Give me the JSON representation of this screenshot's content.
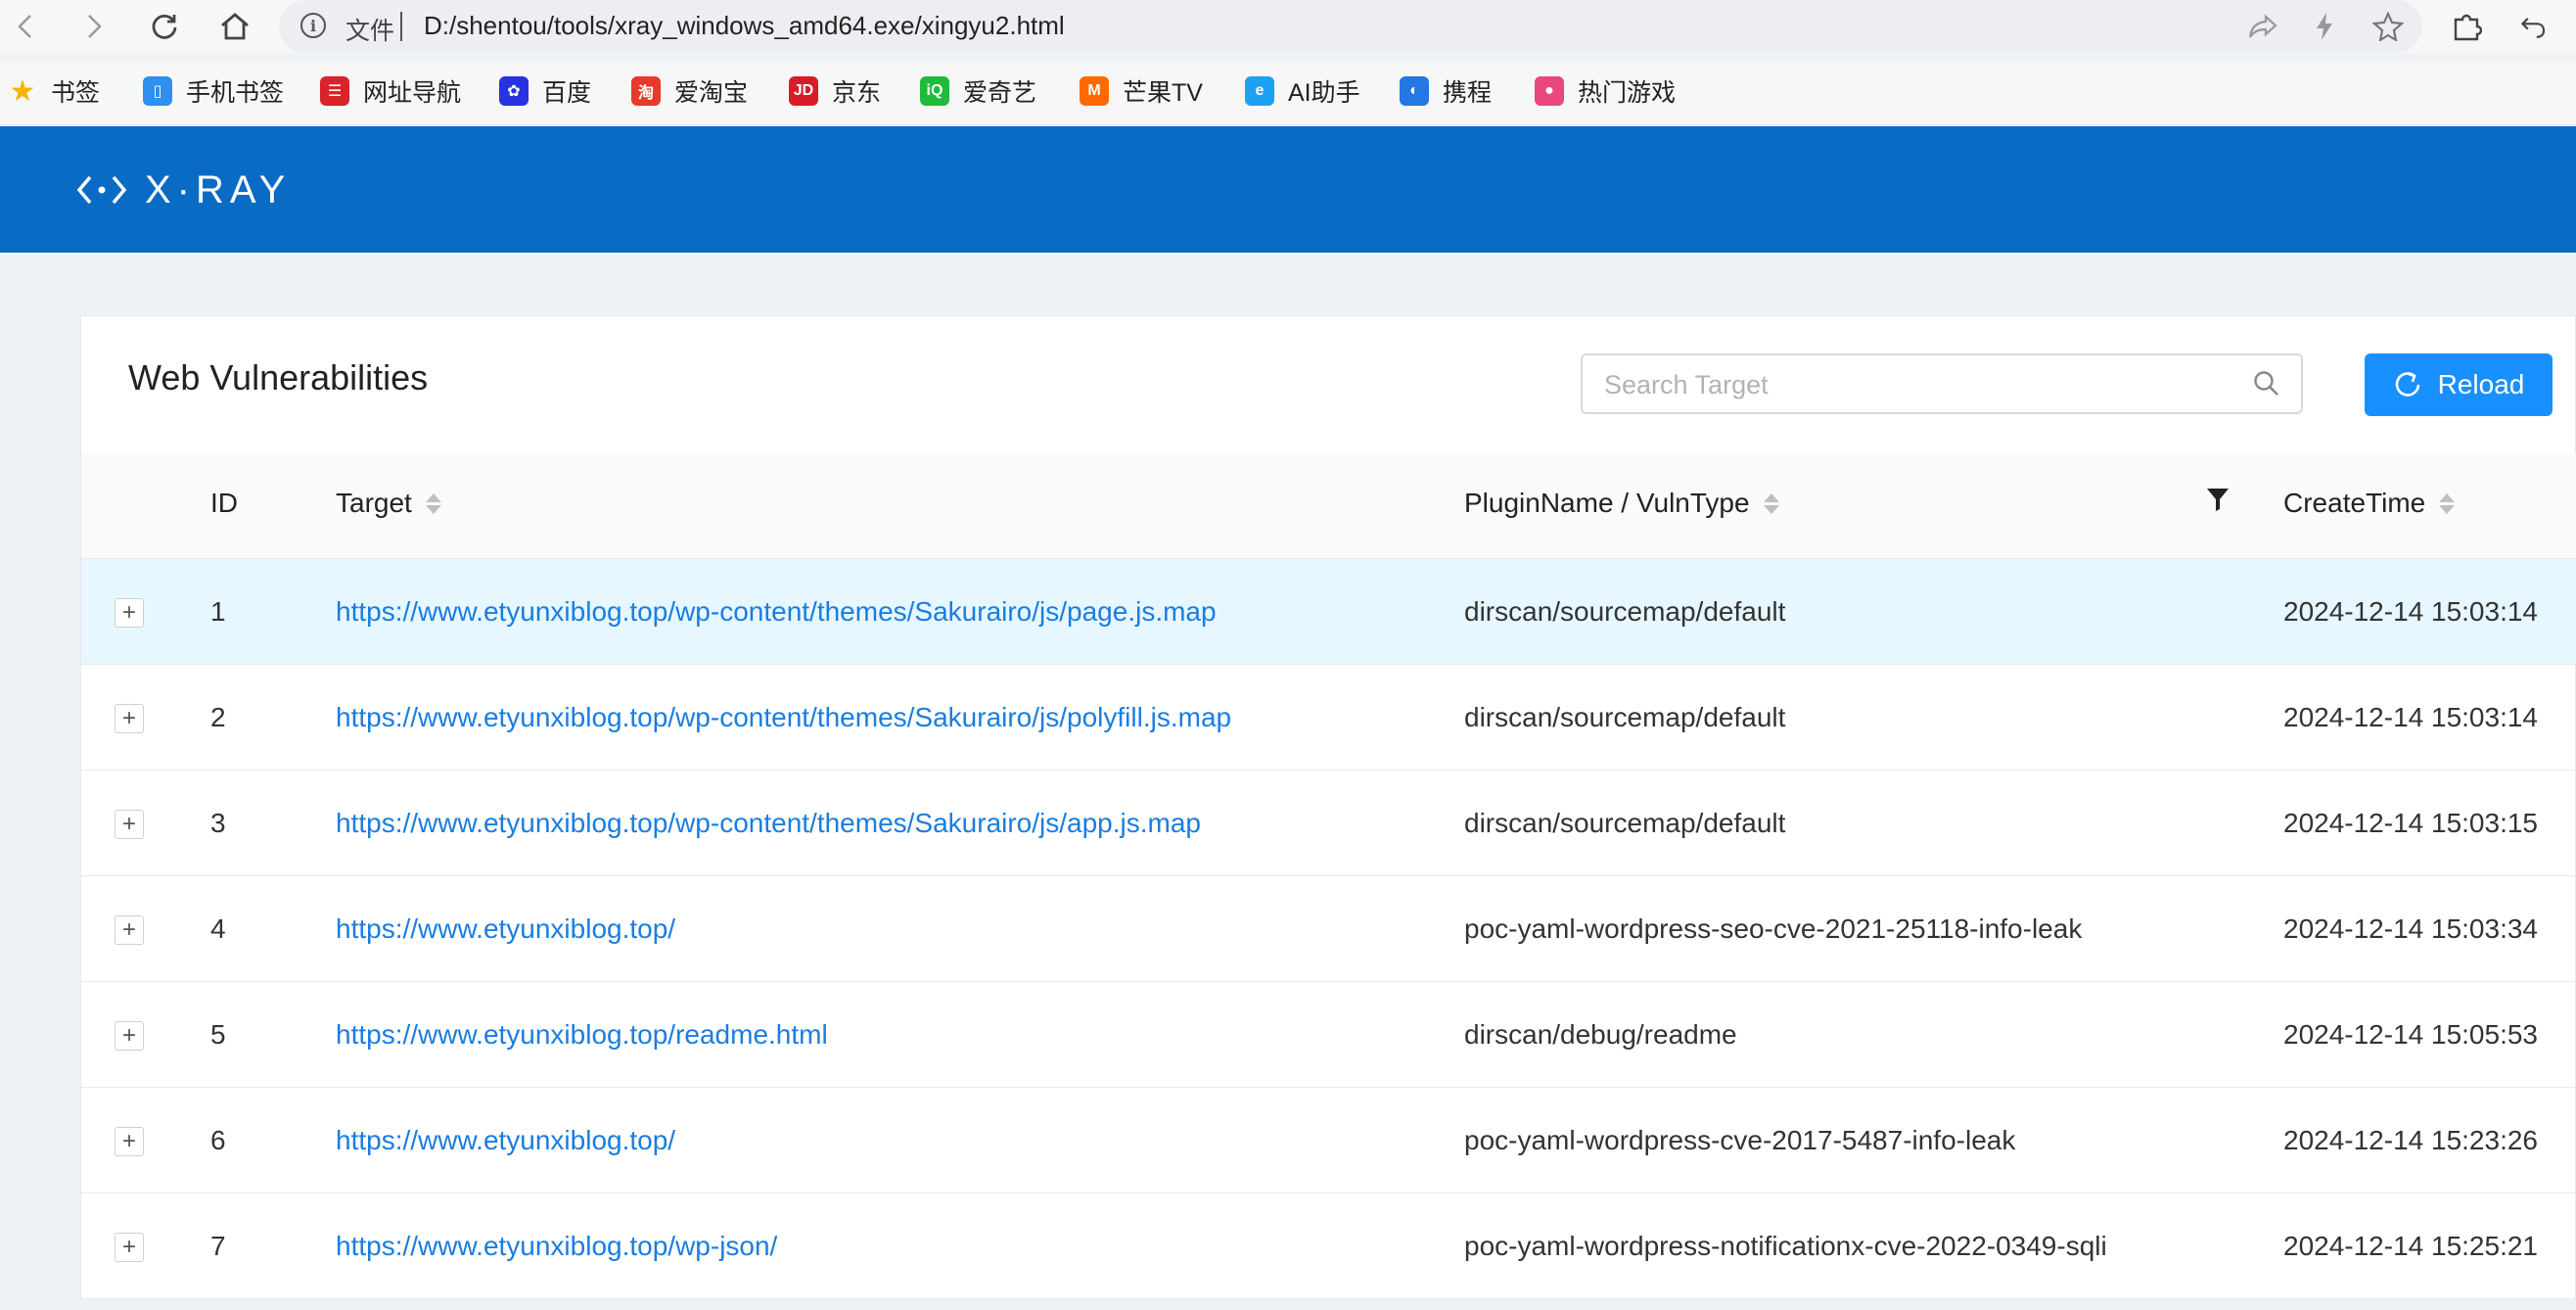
{
  "browser": {
    "scheme_label": "文件",
    "url": "D:/shentou/tools/xray_windows_amd64.exe/xingyu2.html",
    "bookmarks": [
      {
        "label": "书签",
        "icon": "star-icon",
        "color": "#f5b400"
      },
      {
        "label": "手机书签",
        "icon": "phone-icon",
        "color": "#2f8ff0"
      },
      {
        "label": "网址导航",
        "icon": "nav-icon",
        "color": "#d9232b"
      },
      {
        "label": "百度",
        "icon": "baidu-icon",
        "color": "#2932e1"
      },
      {
        "label": "爱淘宝",
        "icon": "taobao-icon",
        "color": "#e8392c"
      },
      {
        "label": "京东",
        "icon": "jd-icon",
        "color": "#d71d2a"
      },
      {
        "label": "爱奇艺",
        "icon": "iqiyi-icon",
        "color": "#1fbb3b"
      },
      {
        "label": "芒果TV",
        "icon": "mango-icon",
        "color": "#ff6a00"
      },
      {
        "label": "AI助手",
        "icon": "ai-icon",
        "color": "#1da1f2"
      },
      {
        "label": "携程",
        "icon": "ctrip-icon",
        "color": "#2577e3"
      },
      {
        "label": "热门游戏",
        "icon": "game-icon",
        "color": "#e9487e"
      }
    ]
  },
  "app": {
    "logo_text": "X·RAY",
    "header_color": "#0a6bc4",
    "accent_color": "#1890ff",
    "link_color": "#1a7de0"
  },
  "card": {
    "title": "Web Vulnerabilities",
    "search_placeholder": "Search Target",
    "reload_label": "Reload"
  },
  "table": {
    "columns": [
      "ID",
      "Target",
      "PluginName / VulnType",
      "CreateTime"
    ],
    "rows": [
      {
        "id": "1",
        "target": "https://www.etyunxiblog.top/wp-content/themes/Sakurairo/js/page.js.map",
        "plugin": "dirscan/sourcemap/default",
        "time": "2024-12-14 15:03:14",
        "highlighted": true
      },
      {
        "id": "2",
        "target": "https://www.etyunxiblog.top/wp-content/themes/Sakurairo/js/polyfill.js.map",
        "plugin": "dirscan/sourcemap/default",
        "time": "2024-12-14 15:03:14"
      },
      {
        "id": "3",
        "target": "https://www.etyunxiblog.top/wp-content/themes/Sakurairo/js/app.js.map",
        "plugin": "dirscan/sourcemap/default",
        "time": "2024-12-14 15:03:15"
      },
      {
        "id": "4",
        "target": "https://www.etyunxiblog.top/",
        "plugin": "poc-yaml-wordpress-seo-cve-2021-25118-info-leak",
        "time": "2024-12-14 15:03:34"
      },
      {
        "id": "5",
        "target": "https://www.etyunxiblog.top/readme.html",
        "plugin": "dirscan/debug/readme",
        "time": "2024-12-14 15:05:53"
      },
      {
        "id": "6",
        "target": "https://www.etyunxiblog.top/",
        "plugin": "poc-yaml-wordpress-cve-2017-5487-info-leak",
        "time": "2024-12-14 15:23:26"
      },
      {
        "id": "7",
        "target": "https://www.etyunxiblog.top/wp-json/",
        "plugin": "poc-yaml-wordpress-notificationx-cve-2022-0349-sqli",
        "time": "2024-12-14 15:25:21"
      }
    ]
  }
}
